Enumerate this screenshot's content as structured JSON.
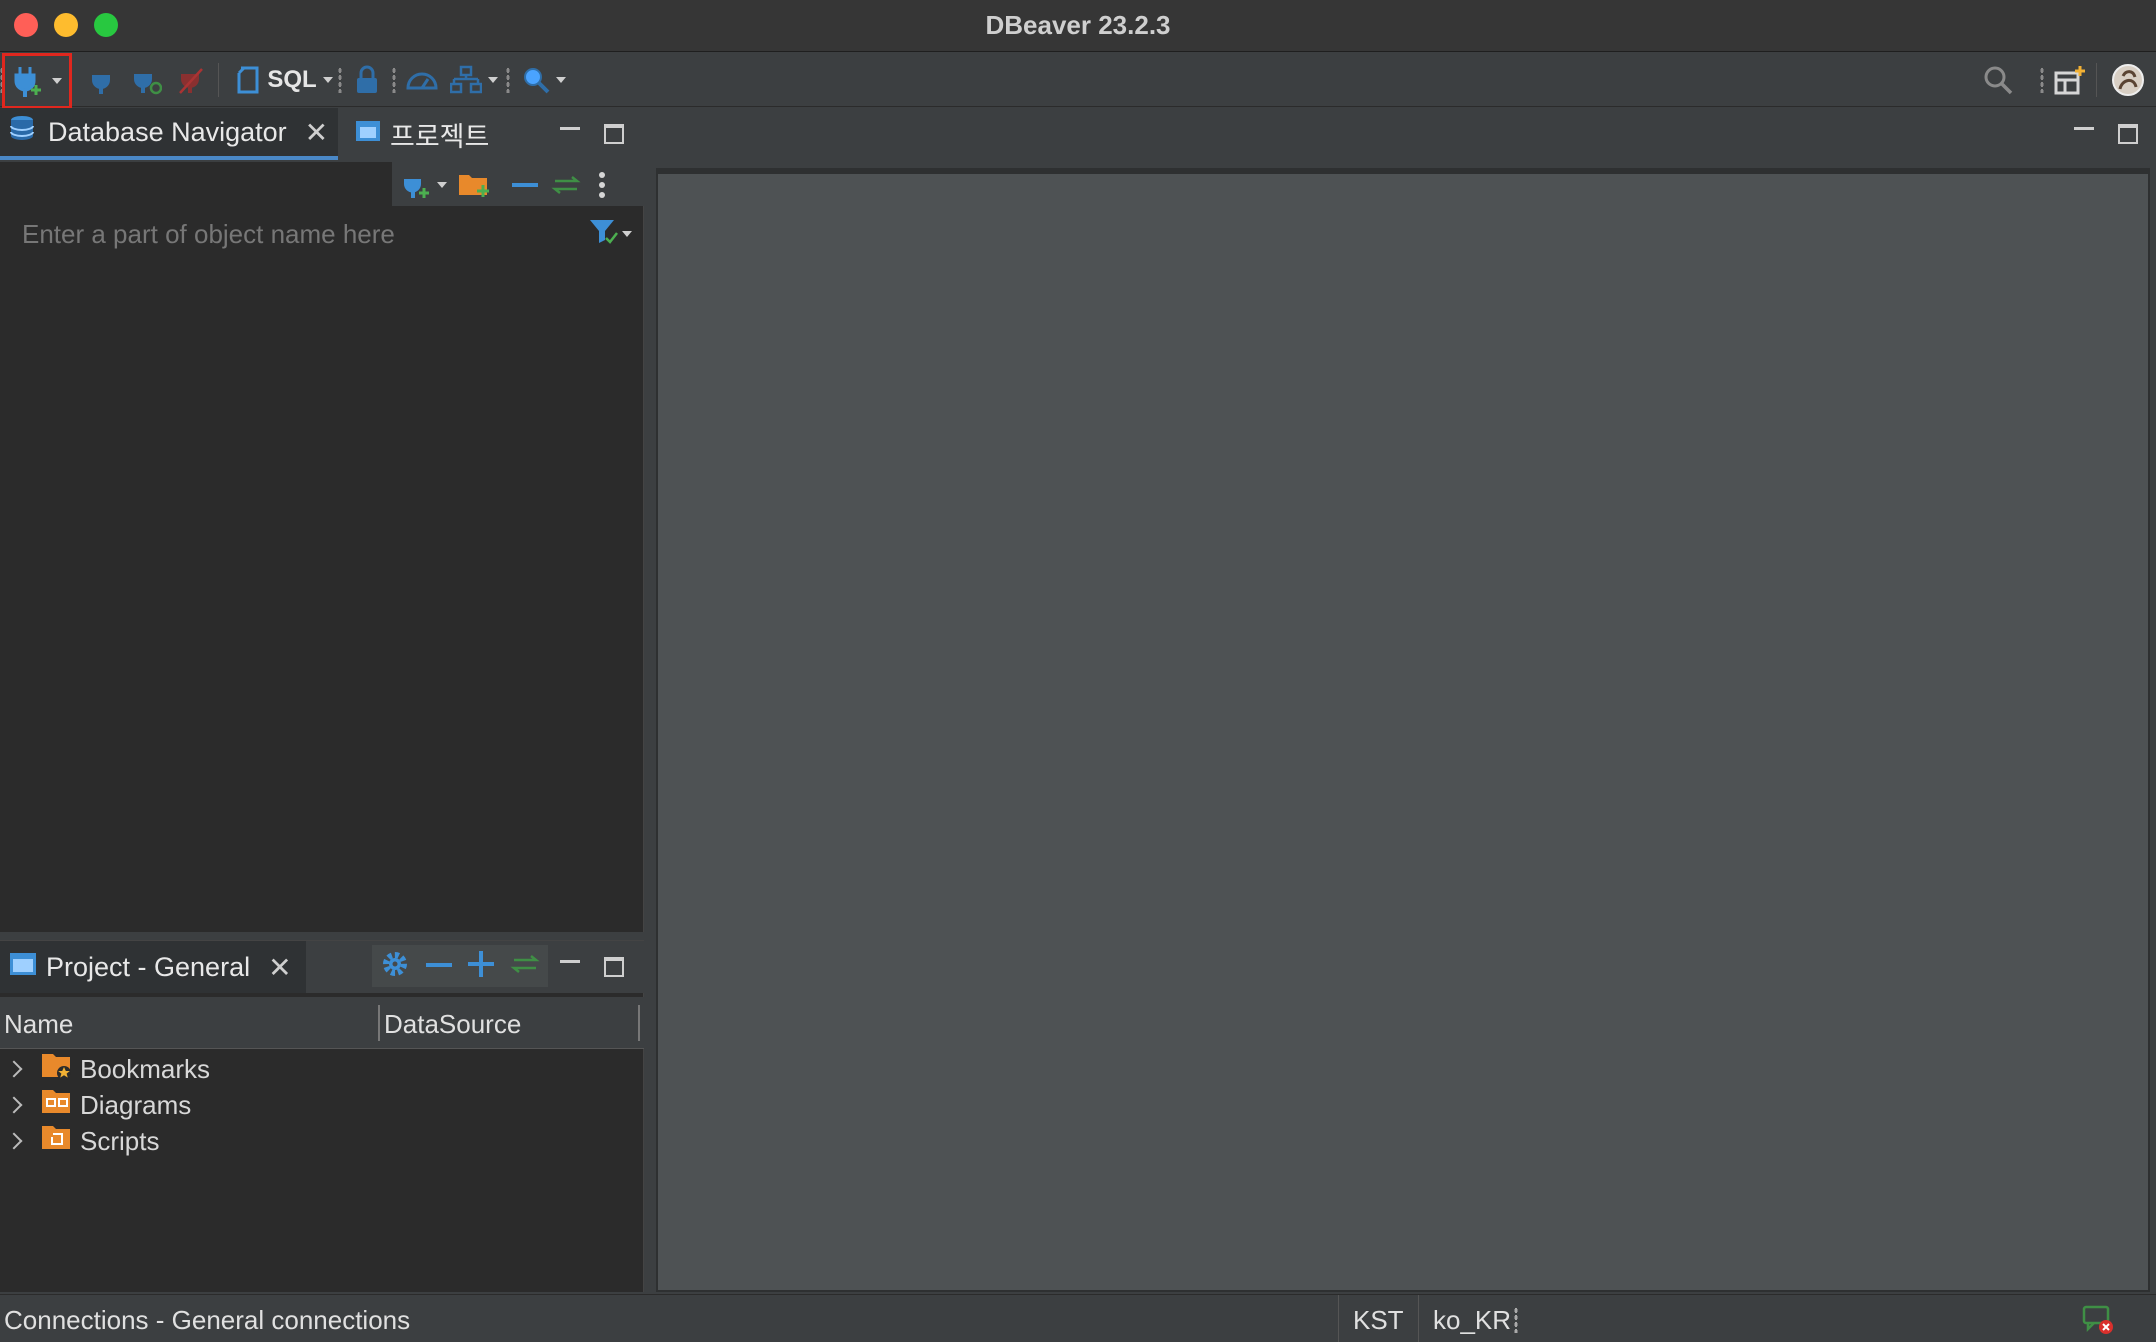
{
  "window": {
    "title": "DBeaver 23.2.3"
  },
  "toolbar": {
    "sql_label": "SQL",
    "icons": [
      "new-connection-icon",
      "connect-icon",
      "reconnect-icon",
      "disconnect-icon",
      "sql-editor-icon",
      "transaction-lock-icon",
      "dashboard-icon",
      "schema-compare-icon",
      "search-icon",
      "global-search-icon",
      "perspective-icon",
      "avatar-icon"
    ]
  },
  "navigator": {
    "tabs": [
      {
        "label": "Database Navigator",
        "active": true
      },
      {
        "label": "프로젝트",
        "active": false
      }
    ],
    "filter_placeholder": "Enter a part of object name here"
  },
  "project_panel": {
    "tab_label": "Project - General",
    "columns": [
      "Name",
      "DataSource"
    ],
    "items": [
      {
        "label": "Bookmarks",
        "icon": "bookmarks-folder-icon"
      },
      {
        "label": "Diagrams",
        "icon": "diagrams-folder-icon"
      },
      {
        "label": "Scripts",
        "icon": "scripts-folder-icon"
      }
    ]
  },
  "statusbar": {
    "left_text": "Connections - General connections",
    "timezone": "KST",
    "locale": "ko_KR"
  },
  "colors": {
    "accent": "#4a88c7",
    "highlight_border": "#e0271e",
    "folder_orange": "#e8892b"
  }
}
